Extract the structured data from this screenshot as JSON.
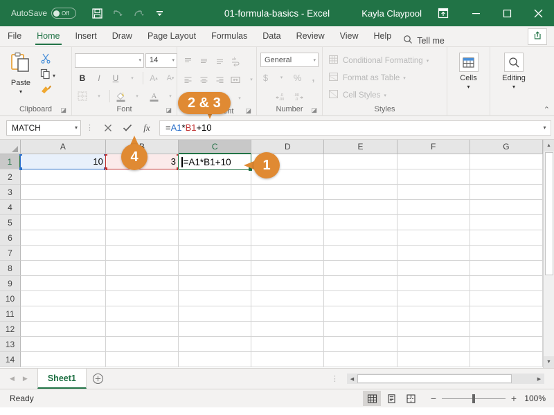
{
  "titlebar": {
    "autosave_label": "AutoSave",
    "autosave_state": "Off",
    "save_icon": "save-icon",
    "undo_icon": "undo-icon",
    "redo_icon": "redo-icon",
    "customize_icon": "customize-qat-icon",
    "document_title": "01-formula-basics  -  Excel",
    "user_name": "Kayla Claypool",
    "ribbon_display_icon": "ribbon-display-options-icon",
    "minimize_icon": "minimize-icon",
    "restore_icon": "restore-icon",
    "close_icon": "close-icon"
  },
  "tabs": [
    {
      "label": "File",
      "active": false
    },
    {
      "label": "Home",
      "active": true
    },
    {
      "label": "Insert",
      "active": false
    },
    {
      "label": "Draw",
      "active": false
    },
    {
      "label": "Page Layout",
      "active": false
    },
    {
      "label": "Formulas",
      "active": false
    },
    {
      "label": "Data",
      "active": false
    },
    {
      "label": "Review",
      "active": false
    },
    {
      "label": "View",
      "active": false
    },
    {
      "label": "Help",
      "active": false
    }
  ],
  "tellme": {
    "label": "Tell me",
    "icon": "search-icon"
  },
  "share": {
    "icon": "share-icon"
  },
  "ribbon": {
    "clipboard": {
      "label": "Clipboard",
      "paste_label": "Paste",
      "paste_icon": "paste-icon",
      "cut_icon": "scissors-icon",
      "copy_icon": "copy-icon",
      "format_painter_icon": "format-painter-icon"
    },
    "font": {
      "label": "Font",
      "font_name": "",
      "font_size": "14",
      "bold": "B",
      "italic": "I",
      "underline": "U",
      "grow_font": "A",
      "shrink_font": "A",
      "borders_icon": "borders-icon",
      "fill_color_icon": "fill-color-icon",
      "font_color_icon": "font-color-icon"
    },
    "alignment": {
      "label": "Alignment",
      "align_top_icon": "align-top-icon",
      "align_middle_icon": "align-middle-icon",
      "align_bottom_icon": "align-bottom-icon",
      "wrap_text_icon": "wrap-text-icon",
      "align_left_icon": "align-left-icon",
      "align_center_icon": "align-center-icon",
      "align_right_icon": "align-right-icon",
      "merge_center_icon": "merge-center-icon",
      "decrease_indent_icon": "decrease-indent-icon",
      "increase_indent_icon": "increase-indent-icon",
      "orientation_icon": "orientation-icon"
    },
    "number": {
      "label": "Number",
      "format": "General",
      "accounting_icon": "currency-icon",
      "percent_icon": "percent-icon",
      "comma_icon": "comma-style-icon",
      "increase_decimal_icon": "increase-decimal-icon",
      "decrease_decimal_icon": "decrease-decimal-icon"
    },
    "styles": {
      "label": "Styles",
      "items": [
        {
          "label": "Conditional Formatting",
          "icon": "conditional-formatting-icon"
        },
        {
          "label": "Format as Table",
          "icon": "format-as-table-icon"
        },
        {
          "label": "Cell Styles",
          "icon": "cell-styles-icon"
        }
      ]
    },
    "cells": {
      "label": "Cells",
      "icon": "cells-icon"
    },
    "editing": {
      "label": "Editing",
      "icon": "find-select-icon"
    },
    "collapse_icon": "collapse-ribbon-icon"
  },
  "formulabar": {
    "namebox_value": "MATCH",
    "namebox_caret": "chevron-down-icon",
    "cancel_icon": "cancel-icon",
    "enter_icon": "enter-checkmark-icon",
    "insert_function_label": "fx",
    "formula_parts": [
      {
        "text": "=",
        "color": "#000000"
      },
      {
        "text": "A1",
        "color": "#2a6fc9"
      },
      {
        "text": "*",
        "color": "#000000"
      },
      {
        "text": "B1",
        "color": "#c03030"
      },
      {
        "text": "+10",
        "color": "#000000"
      }
    ],
    "expand_icon": "expand-formula-bar-icon"
  },
  "grid": {
    "columns": [
      {
        "label": "A",
        "width": 125,
        "selected": false
      },
      {
        "label": "B",
        "width": 107,
        "selected": false
      },
      {
        "label": "C",
        "width": 107,
        "selected": true
      },
      {
        "label": "D",
        "width": 107,
        "selected": false
      },
      {
        "label": "E",
        "width": 107,
        "selected": false
      },
      {
        "label": "F",
        "width": 107,
        "selected": false
      },
      {
        "label": "G",
        "width": 107,
        "selected": false
      }
    ],
    "rows": [
      "1",
      "2",
      "3",
      "4",
      "5",
      "6",
      "7",
      "8",
      "9",
      "10",
      "11",
      "12",
      "13",
      "14"
    ],
    "selected_row": "1",
    "cells": {
      "A1": "10",
      "B1": "3",
      "C1_editing": "=A1*B1+10"
    }
  },
  "sheetbar": {
    "prev_icon": "previous-sheet-icon",
    "next_icon": "next-sheet-icon",
    "sheets": [
      {
        "label": "Sheet1",
        "active": true
      }
    ],
    "add_sheet_icon": "add-sheet-icon",
    "hscroll_left_icon": "scroll-left-icon",
    "hscroll_right_icon": "scroll-right-icon"
  },
  "statusbar": {
    "status": "Ready",
    "views": [
      {
        "name": "normal-view-icon",
        "active": true
      },
      {
        "name": "page-layout-view-icon",
        "active": false
      },
      {
        "name": "page-break-preview-icon",
        "active": false
      }
    ],
    "zoom_out": "−",
    "zoom_in": "+",
    "zoom_level": "100%"
  },
  "callouts": [
    {
      "id": "callout-1",
      "label": "1"
    },
    {
      "id": "callout-2-3",
      "label": "2 & 3"
    },
    {
      "id": "callout-4",
      "label": "4"
    }
  ],
  "colors": {
    "brand_green": "#217346",
    "callout_orange": "#e08a33",
    "ref_blue": "#2a6fc9",
    "ref_red": "#c03030"
  }
}
